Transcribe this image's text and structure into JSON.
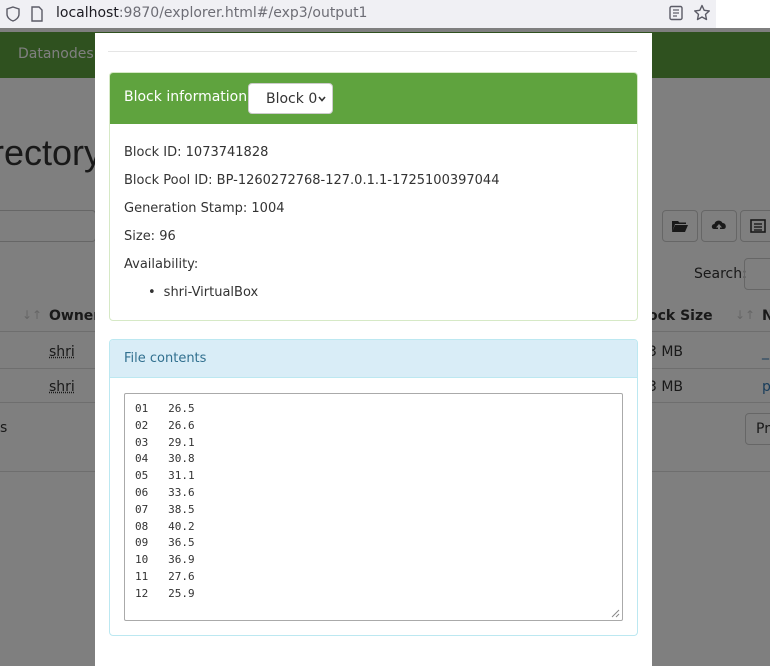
{
  "browser": {
    "url_host": "localhost",
    "url_rest": ":9870/explorer.html#/exp3/output1"
  },
  "background": {
    "nav_item": "Datanodes",
    "heading": "rectory",
    "search_label": "Search:",
    "table": {
      "owner_header": "Owner",
      "block_size_header": "ock Size",
      "name_header_partial": "N",
      "rows": [
        {
          "owner": "shri",
          "block_size": "3 MB",
          "name_partial": "_"
        },
        {
          "owner": "shri",
          "block_size": "3 MB",
          "name_partial": "p"
        }
      ]
    },
    "left_partial_text": "s",
    "pagination_partial": "Pr"
  },
  "modal": {
    "block_panel": {
      "title": "Block information --",
      "selected_block": "Block 0",
      "block_id_label": "Block ID: 1073741828",
      "block_pool_label": "Block Pool ID: BP-1260272768-127.0.1.1-1725100397044",
      "generation_stamp_label": "Generation Stamp: 1004",
      "size_label": "Size: 96",
      "availability_label": "Availability:",
      "availability": [
        "shri-VirtualBox"
      ]
    },
    "file_panel": {
      "title": "File contents",
      "lines": [
        "01   26.5",
        "02   26.6",
        "03   29.1",
        "04   30.8",
        "05   31.1",
        "06   33.6",
        "07   38.5",
        "08   40.2",
        "09   36.5",
        "10   36.9",
        "11   27.6",
        "12   25.9"
      ]
    }
  }
}
